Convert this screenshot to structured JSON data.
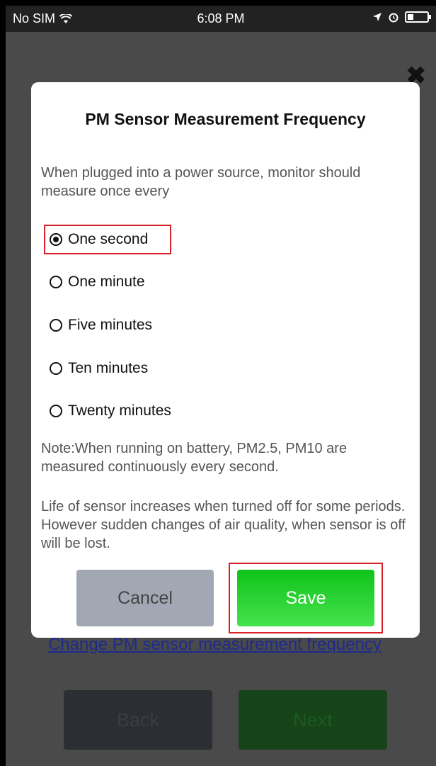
{
  "status_bar": {
    "carrier": "No SIM",
    "time": "6:08 PM"
  },
  "background": {
    "link_text": "Change PM sensor measurement frequency",
    "back_label": "Back",
    "next_label": "Next",
    "close_icon": "close-icon"
  },
  "dialog": {
    "title": "PM Sensor Measurement Frequency",
    "intro": "When plugged into a power source, monitor should measure once every",
    "options": [
      {
        "label": "One second",
        "selected": true
      },
      {
        "label": "One minute",
        "selected": false
      },
      {
        "label": "Five minutes",
        "selected": false
      },
      {
        "label": "Ten minutes",
        "selected": false
      },
      {
        "label": "Twenty minutes",
        "selected": false
      }
    ],
    "note1": "Note:When running on battery, PM2.5, PM10 are measured continuously every second.",
    "note2": "Life of sensor increases when turned off for some periods. However sudden changes of air quality, when sensor is off will be lost.",
    "cancel_label": "Cancel",
    "save_label": "Save"
  },
  "colors": {
    "save_green": "#22cc2a",
    "cancel_gray": "#a1a8b3",
    "highlight_red": "#d7222a"
  }
}
